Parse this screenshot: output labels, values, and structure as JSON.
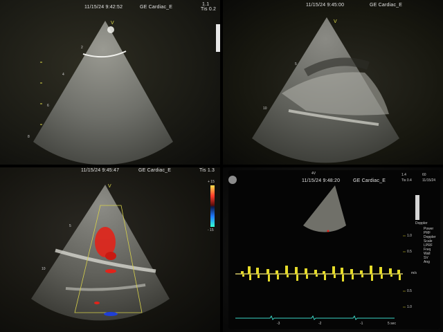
{
  "panels": [
    {
      "header_time": "11/15/24 9:42:52",
      "header_preset": "GE Cardiac_E",
      "mi": "1.1",
      "tis": "Tis 0.2",
      "probe": "V",
      "depth_marks": [
        "2",
        "4",
        "6",
        "8"
      ]
    },
    {
      "header_time": "11/15/24 9:45:00",
      "header_preset": "GE Cardiac_E",
      "probe": "V",
      "depth_marks": [
        "5",
        "10"
      ]
    },
    {
      "header_time": "11/15/24 9:45:47",
      "header_preset": "GE Cardiac_E",
      "tis": "Tis 1.3",
      "probe": "V",
      "depth_marks": [
        "5",
        "10"
      ],
      "color_scale_top": "+ 15",
      "color_scale_bottom": "- 15"
    },
    {
      "probe_name": "4V",
      "header_time": "11/15/24 9:48:20",
      "header_preset": "GE Cardiac_E",
      "mi": "1.4",
      "tis": "Tis 0.4",
      "frame_rate": "60",
      "time_display": "11/15/24",
      "doppler_label": "Doppler",
      "doppler_params": [
        "Power",
        "PRF",
        "Doppler",
        "Scale",
        "LPRF",
        "Freq",
        "Wall",
        "SV",
        "Ang"
      ],
      "scale_values": [
        "1.0",
        "0.5",
        "0.5",
        "1.0"
      ],
      "scale_unit": "m/s",
      "time_marks": [
        "-3",
        "-2",
        "-1"
      ],
      "sweep_label": "5 sec"
    }
  ],
  "colors": {
    "doppler_color": "#e6dc2a",
    "baseline_color": "#ffef7a",
    "ecg_color": "#3bd6c6",
    "flow_red": "#e2231a",
    "flow_blue": "#1f3fd6",
    "sector_outline": "#d8d24a"
  }
}
